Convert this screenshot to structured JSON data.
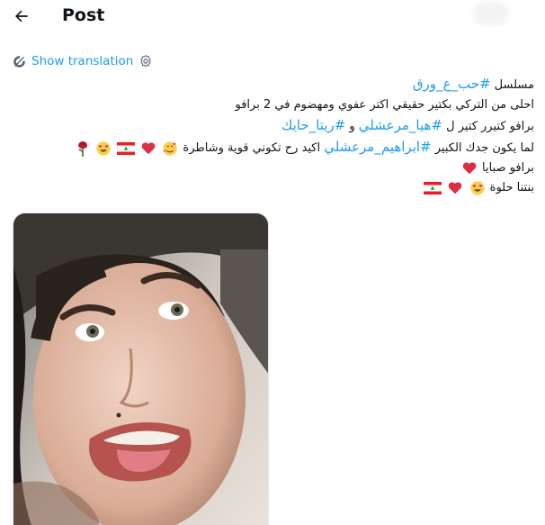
{
  "header": {
    "title": "Post"
  },
  "translation": {
    "label": "Show translation"
  },
  "post": {
    "lines": [
      {
        "text": "مسلسل ",
        "tags": [
          "#حب_ع_ورق"
        ]
      },
      {
        "text": "احلى من التركي بكتير حقيقي اكتر عفوي ومهضوم  في 2 برافو"
      },
      {
        "text": "برافو كتيرر كتير ل ",
        "tags": [
          "#هيا_مرعشلي",
          "#ريتا_حايك"
        ],
        "joiner": " و "
      },
      {
        "text": "لما يكون جدك الكبير ",
        "tags": [
          "#ابراهيم_مرعشلي"
        ],
        "after": " اكيد رح تكوني قوية وشاطرة"
      },
      {
        "text": "برافو صبايا"
      },
      {
        "text": "بنتنا حلوة"
      }
    ]
  },
  "icons": {
    "back": "back-arrow-icon",
    "translate": "translate-icon",
    "settings": "gear-icon",
    "emoji": [
      "smiling-face-with-hearts-icon",
      "red-heart-icon",
      "lebanon-flag-icon",
      "heart-eyes-icon",
      "rose-icon"
    ]
  },
  "colors": {
    "accent": "#1d9bf0",
    "text": "#0f1419"
  }
}
